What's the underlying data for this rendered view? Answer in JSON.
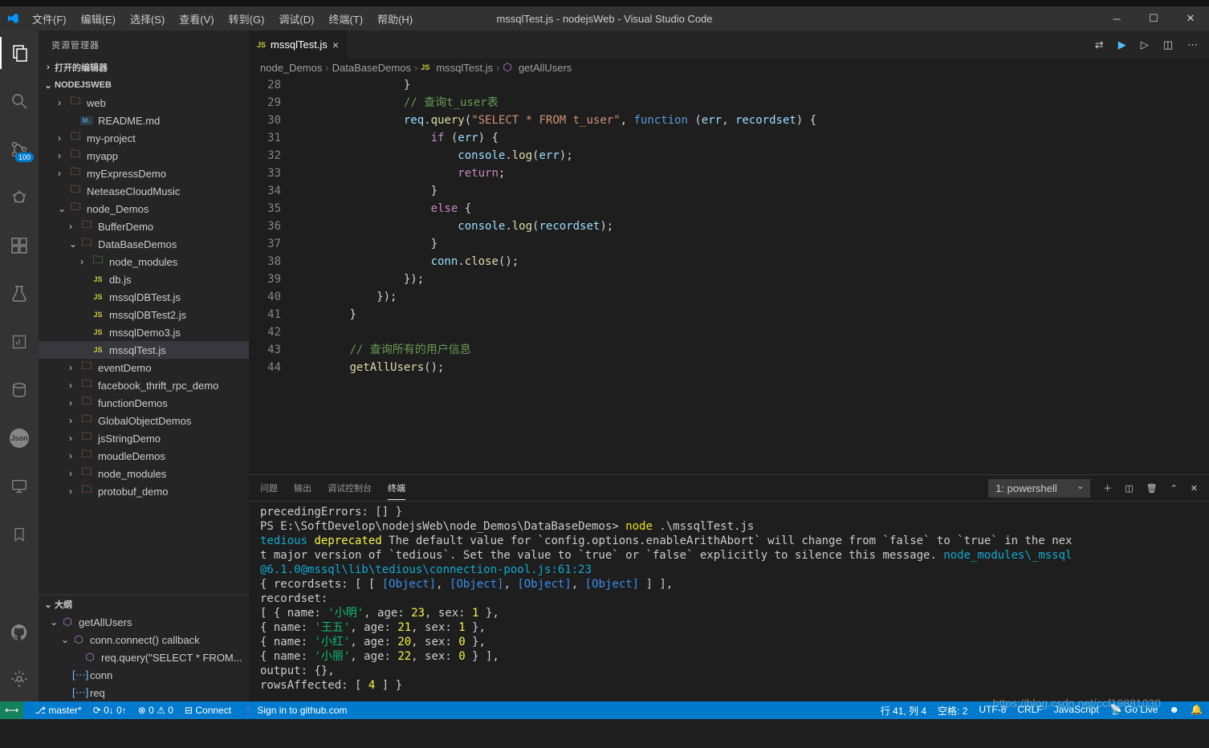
{
  "title": "mssqlTest.js - nodejsWeb - Visual Studio Code",
  "menu": [
    "文件(F)",
    "编辑(E)",
    "选择(S)",
    "查看(V)",
    "转到(G)",
    "调试(D)",
    "终端(T)",
    "帮助(H)"
  ],
  "sidebar_title": "资源管理器",
  "sections": {
    "open_editors": "打开的编辑器",
    "project": "NODEJSWEB",
    "outline": "大纲"
  },
  "scm_badge": "100",
  "tree": {
    "items": [
      {
        "depth": 1,
        "chev": "›",
        "type": "folder",
        "label": "web"
      },
      {
        "depth": 2,
        "chev": "",
        "type": "md",
        "label": "README.md"
      },
      {
        "depth": 1,
        "chev": "›",
        "type": "folder",
        "label": "my-project"
      },
      {
        "depth": 1,
        "chev": "›",
        "type": "folder",
        "label": "myapp"
      },
      {
        "depth": 1,
        "chev": "›",
        "type": "folder",
        "label": "myExpressDemo"
      },
      {
        "depth": 1,
        "chev": "",
        "type": "folder",
        "label": "NeteaseCloudMusic"
      },
      {
        "depth": 1,
        "chev": "⌄",
        "type": "folder",
        "label": "node_Demos"
      },
      {
        "depth": 2,
        "chev": "›",
        "type": "folder",
        "label": "BufferDemo"
      },
      {
        "depth": 2,
        "chev": "⌄",
        "type": "folder",
        "label": "DataBaseDemos"
      },
      {
        "depth": 3,
        "chev": "›",
        "type": "folder-green",
        "label": "node_modules"
      },
      {
        "depth": 3,
        "chev": "",
        "type": "js",
        "label": "db.js"
      },
      {
        "depth": 3,
        "chev": "",
        "type": "js",
        "label": "mssqlDBTest.js"
      },
      {
        "depth": 3,
        "chev": "",
        "type": "js",
        "label": "mssqlDBTest2.js"
      },
      {
        "depth": 3,
        "chev": "",
        "type": "js",
        "label": "mssqlDemo3.js"
      },
      {
        "depth": 3,
        "chev": "",
        "type": "js",
        "label": "mssqlTest.js",
        "active": true
      },
      {
        "depth": 2,
        "chev": "›",
        "type": "folder",
        "label": "eventDemo"
      },
      {
        "depth": 2,
        "chev": "›",
        "type": "folder",
        "label": "facebook_thrift_rpc_demo"
      },
      {
        "depth": 2,
        "chev": "›",
        "type": "folder",
        "label": "functionDemos"
      },
      {
        "depth": 2,
        "chev": "›",
        "type": "folder",
        "label": "GlobalObjectDemos"
      },
      {
        "depth": 2,
        "chev": "›",
        "type": "folder",
        "label": "jsStringDemo"
      },
      {
        "depth": 2,
        "chev": "›",
        "type": "folder",
        "label": "moudleDemos"
      },
      {
        "depth": 2,
        "chev": "›",
        "type": "folder",
        "label": "node_modules"
      },
      {
        "depth": 2,
        "chev": "›",
        "type": "folder",
        "label": "protobuf_demo"
      }
    ]
  },
  "outline_items": [
    {
      "depth": 0,
      "chev": "⌄",
      "icon": "purple",
      "label": "getAllUsers"
    },
    {
      "depth": 1,
      "chev": "⌄",
      "icon": "purple",
      "label": "conn.connect() callback"
    },
    {
      "depth": 2,
      "chev": "",
      "icon": "purple",
      "label": "req.query(\"SELECT * FROM..."
    },
    {
      "depth": 1,
      "chev": "",
      "icon": "blue",
      "label": "conn"
    },
    {
      "depth": 1,
      "chev": "",
      "icon": "blue",
      "label": "req"
    }
  ],
  "tab": {
    "label": "mssqlTest.js"
  },
  "breadcrumbs": [
    "node_Demos",
    "DataBaseDemos",
    "mssqlTest.js",
    "getAllUsers"
  ],
  "code_start": 28,
  "code": [
    {
      "i": 4,
      "html": "<span class='cl-punct'>}</span>"
    },
    {
      "i": 4,
      "html": "<span class='cl-comment'>// 查询t_user表</span>"
    },
    {
      "i": 4,
      "html": "<span class='cl-var'>req</span><span class='cl-punct'>.</span><span class='cl-func'>query</span><span class='cl-punct'>(</span><span class='cl-str'>\"SELECT * FROM t_user\"</span><span class='cl-punct'>, </span><span class='cl-blue'>function</span><span class='cl-punct'> (</span><span class='cl-var'>err</span><span class='cl-punct'>, </span><span class='cl-var'>recordset</span><span class='cl-punct'>) {</span>"
    },
    {
      "i": 5,
      "html": "<span class='cl-keyword'>if</span><span class='cl-punct'> (</span><span class='cl-var'>err</span><span class='cl-punct'>) {</span>"
    },
    {
      "i": 6,
      "html": "<span class='cl-var'>console</span><span class='cl-punct'>.</span><span class='cl-func'>log</span><span class='cl-punct'>(</span><span class='cl-var'>err</span><span class='cl-punct'>);</span>"
    },
    {
      "i": 6,
      "html": "<span class='cl-keyword'>return</span><span class='cl-punct'>;</span>"
    },
    {
      "i": 5,
      "html": "<span class='cl-punct'>}</span>"
    },
    {
      "i": 5,
      "html": "<span class='cl-keyword'>else</span><span class='cl-punct'> {</span>"
    },
    {
      "i": 6,
      "html": "<span class='cl-var'>console</span><span class='cl-punct'>.</span><span class='cl-func'>log</span><span class='cl-punct'>(</span><span class='cl-var'>recordset</span><span class='cl-punct'>);</span>"
    },
    {
      "i": 5,
      "html": "<span class='cl-punct'>}</span>"
    },
    {
      "i": 5,
      "html": "<span class='cl-var'>conn</span><span class='cl-punct'>.</span><span class='cl-func'>close</span><span class='cl-punct'>();</span>"
    },
    {
      "i": 4,
      "html": "<span class='cl-punct'>});</span>"
    },
    {
      "i": 3,
      "html": "<span class='cl-punct'>});</span>"
    },
    {
      "i": 2,
      "html": "<span class='cl-punct'>}</span>"
    },
    {
      "i": 0,
      "html": ""
    },
    {
      "i": 2,
      "html": "<span class='cl-comment'>// 查询所有的用户信息</span>"
    },
    {
      "i": 2,
      "html": "<span class='cl-func'>getAllUsers</span><span class='cl-punct'>();</span>"
    }
  ],
  "panel": {
    "tabs": [
      "问题",
      "输出",
      "调试控制台",
      "终端"
    ],
    "active_tab": 3,
    "dropdown": "1: powershell"
  },
  "terminal_lines": [
    {
      "html": "  precedingErrors: [] }"
    },
    {
      "html": "PS E:\\SoftDevelop\\nodejsWeb\\node_Demos\\DataBaseDemos> <span class='t-yellow'>node</span> .\\mssqlTest.js"
    },
    {
      "html": "<span class='t-cyan'>tedious</span> <span class='t-dyellow'>deprecated</span> The default value for `config.options.enableArithAbort` will change from `false` to `true` in the nex"
    },
    {
      "html": "t major version of `tedious`. Set the value to `true` or `false` explicitly to silence this message. <span class='t-cyan'>node_modules\\_mssql</span>"
    },
    {
      "html": "<span class='t-cyan'>@6.1.0@mssql\\lib\\tedious\\connection-pool.js:61:23</span>"
    },
    {
      "html": "{ recordsets: [ [ <span class='t-blue'>[Object]</span>, <span class='t-blue'>[Object]</span>, <span class='t-blue'>[Object]</span>, <span class='t-blue'>[Object]</span> ] ],"
    },
    {
      "html": "  recordset:"
    },
    {
      "html": "   [ { name: <span class='t-green'>'小明'</span>, age: <span class='t-dyellow'>23</span>, sex: <span class='t-dyellow'>1</span> },"
    },
    {
      "html": "     { name: <span class='t-green'>'王五'</span>, age: <span class='t-dyellow'>21</span>, sex: <span class='t-dyellow'>1</span> },"
    },
    {
      "html": "     { name: <span class='t-green'>'小红'</span>, age: <span class='t-dyellow'>20</span>, sex: <span class='t-dyellow'>0</span> },"
    },
    {
      "html": "     { name: <span class='t-green'>'小丽'</span>, age: <span class='t-dyellow'>22</span>, sex: <span class='t-dyellow'>0</span> } ],"
    },
    {
      "html": "  output: {},"
    },
    {
      "html": "  rowsAffected: [ <span class='t-dyellow'>4</span> ] }"
    }
  ],
  "status": {
    "left": [
      "master*",
      "⟳ 0↓ 0↑",
      "⊗ 0 ⚠ 0",
      "Connect",
      "Sign in to github.com"
    ],
    "right": [
      "行 41, 列 4",
      "空格: 2",
      "UTF-8",
      "CRLF",
      "JavaScript",
      "Go Live"
    ]
  },
  "watermark": "https://blog.csdn.net/ccf19881030"
}
